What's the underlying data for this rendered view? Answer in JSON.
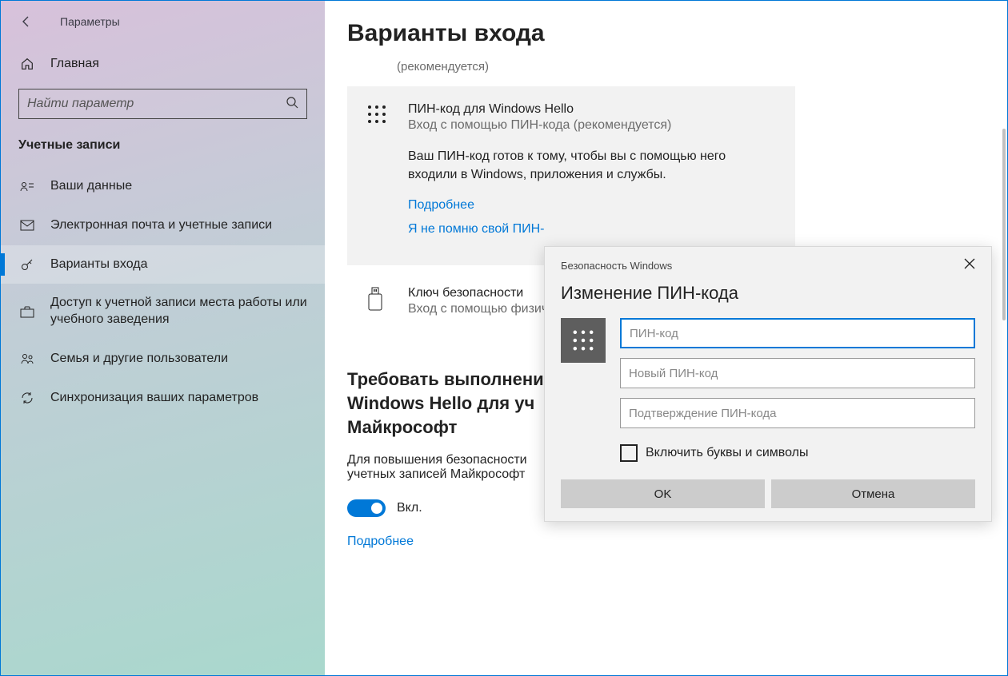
{
  "app_title": "Параметры",
  "home_label": "Главная",
  "search_placeholder": "Найти параметр",
  "section_title": "Учетные записи",
  "nav": [
    {
      "label": "Ваши данные"
    },
    {
      "label": "Электронная почта и учетные записи"
    },
    {
      "label": "Варианты входа"
    },
    {
      "label": "Доступ к учетной записи места работы или учебного заведения"
    },
    {
      "label": "Семья и другие пользователи"
    },
    {
      "label": "Синхронизация ваших параметров"
    }
  ],
  "page_title": "Варианты входа",
  "recommended": "(рекомендуется)",
  "pin_card": {
    "title": "ПИН-код для Windows Hello",
    "sub": "Вход с помощью ПИН-кода (рекомендуется)",
    "desc": "Ваш ПИН-код готов к тому, чтобы вы с помощью него входили в Windows, приложения и службы.",
    "link_more": "Подробнее",
    "link_forgot": "Я не помню свой ПИН-"
  },
  "key_card": {
    "title": "Ключ безопасности",
    "sub": "Вход с помощью физич"
  },
  "hello_section": {
    "heading": "Требовать выполнени\nWindows Hello для уч\nМайкрософт",
    "desc": "Для повышения безопасности\nучетных записей Майкрософт",
    "toggle_label": "Вкл.",
    "more": "Подробнее"
  },
  "dialog": {
    "caption": "Безопасность Windows",
    "title": "Изменение ПИН-кода",
    "field_current": "ПИН-код",
    "field_new": "Новый ПИН-код",
    "field_confirm": "Подтверждение ПИН-кода",
    "checkbox": "Включить буквы и символы",
    "ok": "OK",
    "cancel": "Отмена"
  }
}
